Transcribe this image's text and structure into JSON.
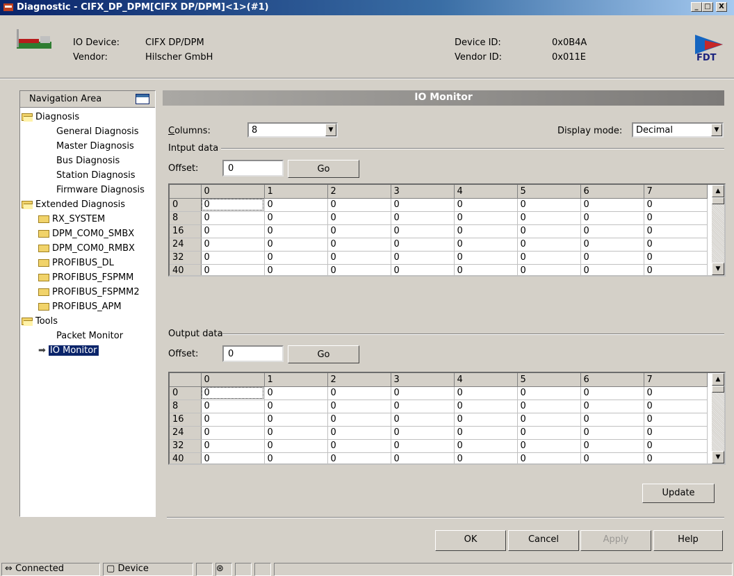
{
  "window": {
    "title": "Diagnostic - CIFX_DP_DPM[CIFX DP/DPM]<1>(#1)",
    "controls": [
      "_",
      "□",
      "X"
    ]
  },
  "device": {
    "io_device_label": "IO Device:",
    "io_device_value": "CIFX DP/DPM",
    "vendor_label": "Vendor:",
    "vendor_value": "Hilscher GmbH",
    "device_id_label": "Device ID:",
    "device_id_value": "0x0B4A",
    "vendor_id_label": "Vendor ID:",
    "vendor_id_value": "0x011E",
    "logo_text": "FDT"
  },
  "nav": {
    "title": "Navigation Area",
    "items": [
      {
        "label": "Diagnosis",
        "type": "folder-open",
        "level": 0
      },
      {
        "label": "General Diagnosis",
        "type": "leaf",
        "level": 1
      },
      {
        "label": "Master Diagnosis",
        "type": "leaf",
        "level": 1
      },
      {
        "label": "Bus Diagnosis",
        "type": "leaf",
        "level": 1
      },
      {
        "label": "Station Diagnosis",
        "type": "leaf",
        "level": 1
      },
      {
        "label": "Firmware Diagnosis",
        "type": "leaf",
        "level": 1
      },
      {
        "label": "Extended Diagnosis",
        "type": "folder-open",
        "level": 0
      },
      {
        "label": "RX_SYSTEM",
        "type": "folder",
        "level": 1
      },
      {
        "label": "DPM_COM0_SMBX",
        "type": "folder",
        "level": 1
      },
      {
        "label": "DPM_COM0_RMBX",
        "type": "folder",
        "level": 1
      },
      {
        "label": "PROFIBUS_DL",
        "type": "folder",
        "level": 1
      },
      {
        "label": "PROFIBUS_FSPMM",
        "type": "folder",
        "level": 1
      },
      {
        "label": "PROFIBUS_FSPMM2",
        "type": "folder",
        "level": 1
      },
      {
        "label": "PROFIBUS_APM",
        "type": "folder",
        "level": 1
      },
      {
        "label": "Tools",
        "type": "folder-open",
        "level": 0
      },
      {
        "label": "Packet Monitor",
        "type": "leaf",
        "level": 1
      },
      {
        "label": "IO Monitor",
        "type": "selected",
        "level": 1
      }
    ]
  },
  "io_monitor": {
    "title": "IO Monitor",
    "columns_label": "Columns:",
    "columns_value": "8",
    "display_mode_label": "Display mode:",
    "display_mode_value": "Decimal",
    "input": {
      "group_label": "Intput data",
      "offset_label": "Offset:",
      "offset_value": "0",
      "go_label": "Go"
    },
    "output": {
      "group_label": "Output data",
      "offset_label": "Offset:",
      "offset_value": "0",
      "go_label": "Go"
    },
    "grid_columns": [
      "0",
      "1",
      "2",
      "3",
      "4",
      "5",
      "6",
      "7"
    ],
    "grid_rows": [
      "0",
      "8",
      "16",
      "24",
      "32",
      "40"
    ],
    "cell_value": "0",
    "update_label": "Update"
  },
  "buttons": {
    "ok": "OK",
    "cancel": "Cancel",
    "apply": "Apply",
    "help": "Help"
  },
  "status": {
    "connected": "Connected",
    "device": "Device"
  }
}
